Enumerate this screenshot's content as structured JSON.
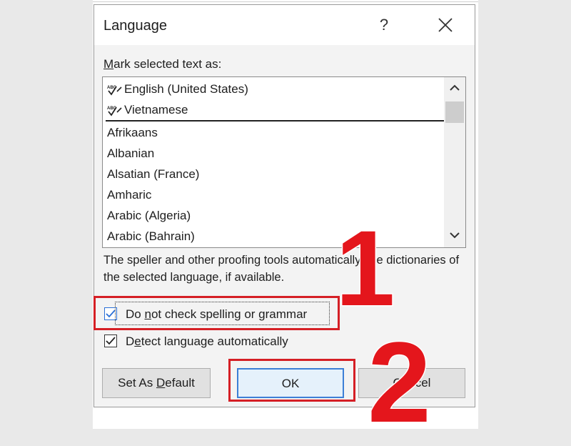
{
  "dialog": {
    "title": "Language",
    "help_glyph": "?",
    "mark_label_pre": "",
    "mark_label_underline": "M",
    "mark_label_post": "ark selected text as:"
  },
  "languages": {
    "proofed": [
      "English (United States)",
      "Vietnamese"
    ],
    "others": [
      "Afrikaans",
      "Albanian",
      "Alsatian (France)",
      "Amharic",
      "Arabic (Algeria)",
      "Arabic (Bahrain)"
    ]
  },
  "description": "The speller and other proofing tools automatically use dictionaries of the selected language, if available.",
  "checkboxes": {
    "no_check_pre": "Do ",
    "no_check_underline": "n",
    "no_check_post": "ot check spelling or grammar",
    "no_check_checked": true,
    "detect_pre": "D",
    "detect_underline": "e",
    "detect_post": "tect language automatically",
    "detect_checked": true
  },
  "buttons": {
    "set_default_pre": "Set As ",
    "set_default_underline": "D",
    "set_default_post": "efault",
    "ok": "OK",
    "cancel": "Cancel"
  },
  "annotations": {
    "step1": "1",
    "step2": "2",
    "color": "#e4161c"
  }
}
